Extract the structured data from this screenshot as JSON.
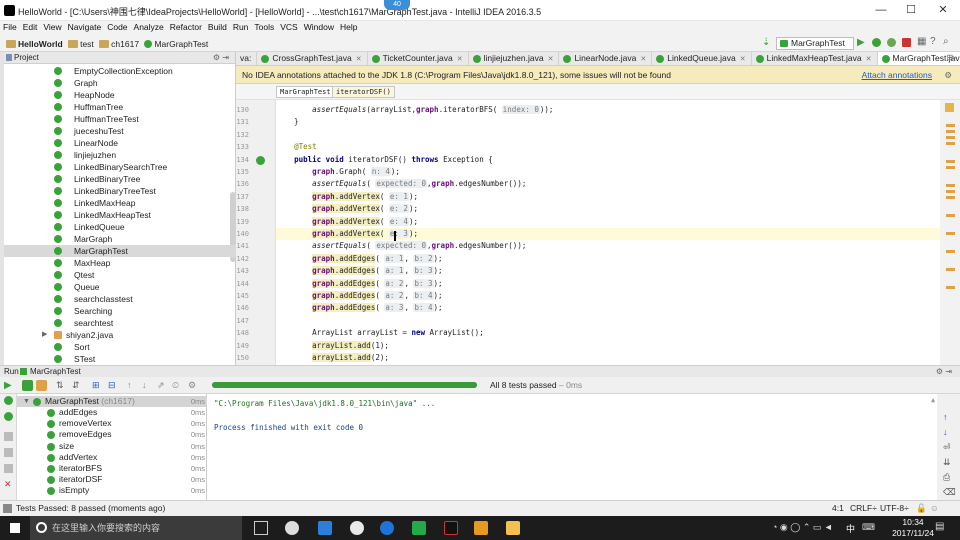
{
  "window": {
    "title": "HelloWorld - [C:\\Users\\神围七律\\IdeaProjects\\HelloWorld] - [HelloWorld] - ...\\test\\ch1617\\MarGraphTest.java - IntelliJ IDEA 2016.3.5",
    "badge": "40",
    "minimize": "—",
    "maximize": "☐",
    "close": "✕"
  },
  "menu": [
    "File",
    "Edit",
    "View",
    "Navigate",
    "Code",
    "Analyze",
    "Refactor",
    "Build",
    "Run",
    "Tools",
    "VCS",
    "Window",
    "Help"
  ],
  "navbar": {
    "crumbs": [
      "HelloWorld",
      "test",
      "ch1617",
      "MarGraphTest"
    ],
    "run_config": "MarGraphTest"
  },
  "project": {
    "header": "Project",
    "items": [
      {
        "label": "EmptyCollectionException",
        "type": "class"
      },
      {
        "label": "Graph",
        "type": "class"
      },
      {
        "label": "HeapNode",
        "type": "class"
      },
      {
        "label": "HuffmanTree",
        "type": "class"
      },
      {
        "label": "HuffmanTreeTest",
        "type": "class"
      },
      {
        "label": "jueceshuTest",
        "type": "class"
      },
      {
        "label": "LinearNode",
        "type": "class"
      },
      {
        "label": "linjiejuzhen",
        "type": "class"
      },
      {
        "label": "LinkedBinarySearchTree",
        "type": "class"
      },
      {
        "label": "LinkedBinaryTree",
        "type": "class"
      },
      {
        "label": "LinkedBinaryTreeTest",
        "type": "class"
      },
      {
        "label": "LinkedMaxHeap",
        "type": "class"
      },
      {
        "label": "LinkedMaxHeapTest",
        "type": "class"
      },
      {
        "label": "LinkedQueue",
        "type": "class"
      },
      {
        "label": "MarGraph",
        "type": "class"
      },
      {
        "label": "MarGraphTest",
        "type": "class",
        "selected": true
      },
      {
        "label": "MaxHeap",
        "type": "class"
      },
      {
        "label": "Qtest",
        "type": "class"
      },
      {
        "label": "Queue",
        "type": "class"
      },
      {
        "label": "searchclasstest",
        "type": "class"
      },
      {
        "label": "Searching",
        "type": "class"
      },
      {
        "label": "searchtest",
        "type": "class"
      },
      {
        "label": "shiyan2.java",
        "type": "file"
      },
      {
        "label": "Sort",
        "type": "class"
      },
      {
        "label": "STest",
        "type": "class"
      }
    ]
  },
  "tabs": [
    {
      "label": "va:"
    },
    {
      "label": "CrossGraphTest.java"
    },
    {
      "label": "TicketCounter.java"
    },
    {
      "label": "linjiejuzhen.java"
    },
    {
      "label": "LinearNode.java"
    },
    {
      "label": "LinkedQueue.java"
    },
    {
      "label": "LinkedMaxHeapTest.java"
    },
    {
      "label": "MarGraphTest.java",
      "active": true
    }
  ],
  "banner": {
    "text": "No IDEA annotations attached to the JDK 1.8 (C:\\Program Files\\Java\\jdk1.8.0_121), some issues will not be found",
    "link": "Attach annotations"
  },
  "editor_breadcrumb": [
    "MarGraphTest",
    "iteratorDSF()"
  ],
  "code_lines": [
    {
      "n": "130",
      "html": "        <span class=\"it\">assertEquals</span>(arrayList,<span class=\"fld\">graph</span>.iteratorBFS( <span class=\"hint\">index: 0</span>));"
    },
    {
      "n": "131",
      "html": "    }"
    },
    {
      "n": "132",
      "html": ""
    },
    {
      "n": "133",
      "html": "    <span class=\"ann\">@Test</span>"
    },
    {
      "n": "134",
      "html": "    <span class=\"kw\">public void</span> iteratorDSF() <span class=\"kw\">throws</span> Exception {"
    },
    {
      "n": "135",
      "html": "        <span class=\"fld\">graph</span>.Graph( <span class=\"hint\">n: 4</span>);"
    },
    {
      "n": "136",
      "html": "        <span class=\"it\">assertEquals</span>( <span class=\"hint\">expected: 0</span>,<span class=\"fld\">graph</span>.edgesNumber());"
    },
    {
      "n": "137",
      "html": "        <span class=\"warnbg\"><span class=\"fld\">graph</span>.addVertex</span>( <span class=\"hint\">e: 1</span>);"
    },
    {
      "n": "138",
      "html": "        <span class=\"warnbg\"><span class=\"fld\">graph</span>.addVertex</span>( <span class=\"hint\">e: 2</span>);"
    },
    {
      "n": "139",
      "html": "        <span class=\"warnbg\"><span class=\"fld\">graph</span>.addVertex</span>( <span class=\"hint\">e: 4</span>);"
    },
    {
      "n": "140",
      "html": "        <span class=\"warnbg\"><span class=\"fld\">graph</span>.addVertex</span>( <span class=\"hint\">e: 3</span>);",
      "hl": true
    },
    {
      "n": "141",
      "html": "        <span class=\"it\">assertEquals</span>( <span class=\"hint\">expected: 0</span>,<span class=\"fld\">graph</span>.edgesNumber());"
    },
    {
      "n": "142",
      "html": "        <span class=\"warnbg\"><span class=\"fld\">graph</span>.addEdges</span>( <span class=\"hint\">a: 1</span>, <span class=\"hint\">b: 2</span>);"
    },
    {
      "n": "143",
      "html": "        <span class=\"warnbg\"><span class=\"fld\">graph</span>.addEdges</span>( <span class=\"hint\">a: 1</span>, <span class=\"hint\">b: 3</span>);"
    },
    {
      "n": "144",
      "html": "        <span class=\"warnbg\"><span class=\"fld\">graph</span>.addEdges</span>( <span class=\"hint\">a: 2</span>, <span class=\"hint\">b: 3</span>);"
    },
    {
      "n": "145",
      "html": "        <span class=\"warnbg\"><span class=\"fld\">graph</span>.addEdges</span>( <span class=\"hint\">a: 2</span>, <span class=\"hint\">b: 4</span>);"
    },
    {
      "n": "146",
      "html": "        <span class=\"warnbg\"><span class=\"fld\">graph</span>.addEdges</span>( <span class=\"hint\">a: 3</span>, <span class=\"hint\">b: 4</span>);"
    },
    {
      "n": "147",
      "html": ""
    },
    {
      "n": "148",
      "html": "        ArrayList arrayList = <span class=\"kw\">new</span> ArrayList();"
    },
    {
      "n": "149",
      "html": "        <span class=\"warnbg\">arrayList.add</span>(1);"
    },
    {
      "n": "150",
      "html": "        <span class=\"warnbg\">arrayList.add</span>(2);"
    }
  ],
  "run": {
    "header": "Run",
    "config": "MarGraphTest",
    "progress": 1.0,
    "summary": "All 8 tests passed",
    "summary_time": "– 0ms",
    "root": {
      "label": "MarGraphTest",
      "pkg": "(ch1617)",
      "time": "0ms"
    },
    "tests": [
      {
        "label": "addEdges",
        "time": "0ms"
      },
      {
        "label": "removeVertex",
        "time": "0ms"
      },
      {
        "label": "removeEdges",
        "time": "0ms"
      },
      {
        "label": "size",
        "time": "0ms"
      },
      {
        "label": "addVertex",
        "time": "0ms"
      },
      {
        "label": "iteratorBFS",
        "time": "0ms"
      },
      {
        "label": "iteratorDSF",
        "time": "0ms"
      },
      {
        "label": "isEmpty",
        "time": "0ms"
      }
    ],
    "console": [
      "\"C:\\Program Files\\Java\\jdk1.8.0_121\\bin\\java\" ...",
      "",
      "Process finished with exit code 0"
    ]
  },
  "status": {
    "left": "Tests Passed: 8 passed (moments ago)",
    "position": "4:1",
    "line_sep": "CRLF÷",
    "encoding": "UTF-8÷"
  },
  "taskbar": {
    "search_placeholder": "在这里输入你要搜索的内容",
    "ime": "中",
    "time": "10:34",
    "date": "2017/11/24"
  },
  "colors": {
    "pass": "#3aa23a",
    "accent": "#2359c5",
    "banner": "#f6ebbc"
  }
}
